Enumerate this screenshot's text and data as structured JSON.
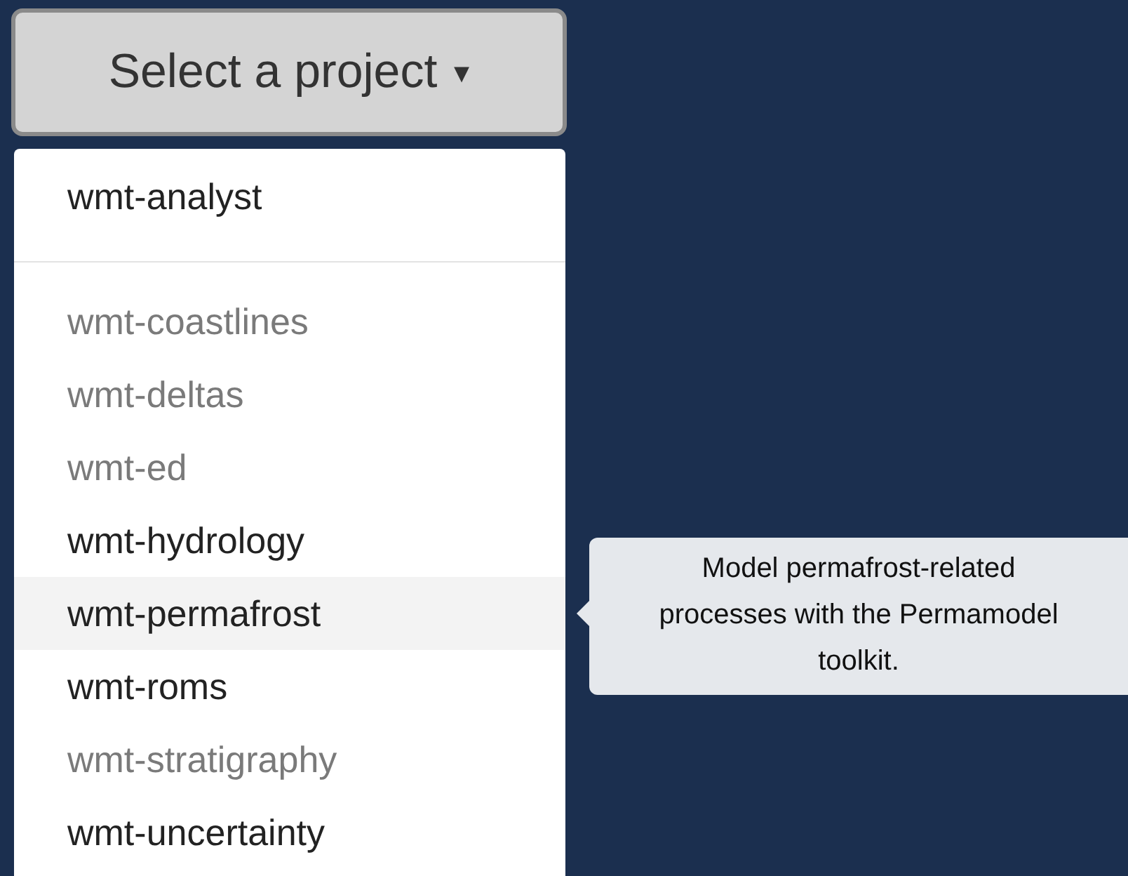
{
  "dropdown": {
    "label": "Select a project",
    "caret": "▾"
  },
  "menu": {
    "groups": [
      {
        "items": [
          {
            "label": "wmt-analyst",
            "disabled": false,
            "selected": false
          }
        ]
      },
      {
        "items": [
          {
            "label": "wmt-coastlines",
            "disabled": true,
            "selected": false
          },
          {
            "label": "wmt-deltas",
            "disabled": true,
            "selected": false
          },
          {
            "label": "wmt-ed",
            "disabled": true,
            "selected": false
          },
          {
            "label": "wmt-hydrology",
            "disabled": false,
            "selected": false
          },
          {
            "label": "wmt-permafrost",
            "disabled": false,
            "selected": true
          },
          {
            "label": "wmt-roms",
            "disabled": false,
            "selected": false
          },
          {
            "label": "wmt-stratigraphy",
            "disabled": true,
            "selected": false
          },
          {
            "label": "wmt-uncertainty",
            "disabled": false,
            "selected": false
          }
        ]
      }
    ]
  },
  "tooltip": {
    "text": "Model permafrost-related processes with the Permamodel toolkit."
  }
}
